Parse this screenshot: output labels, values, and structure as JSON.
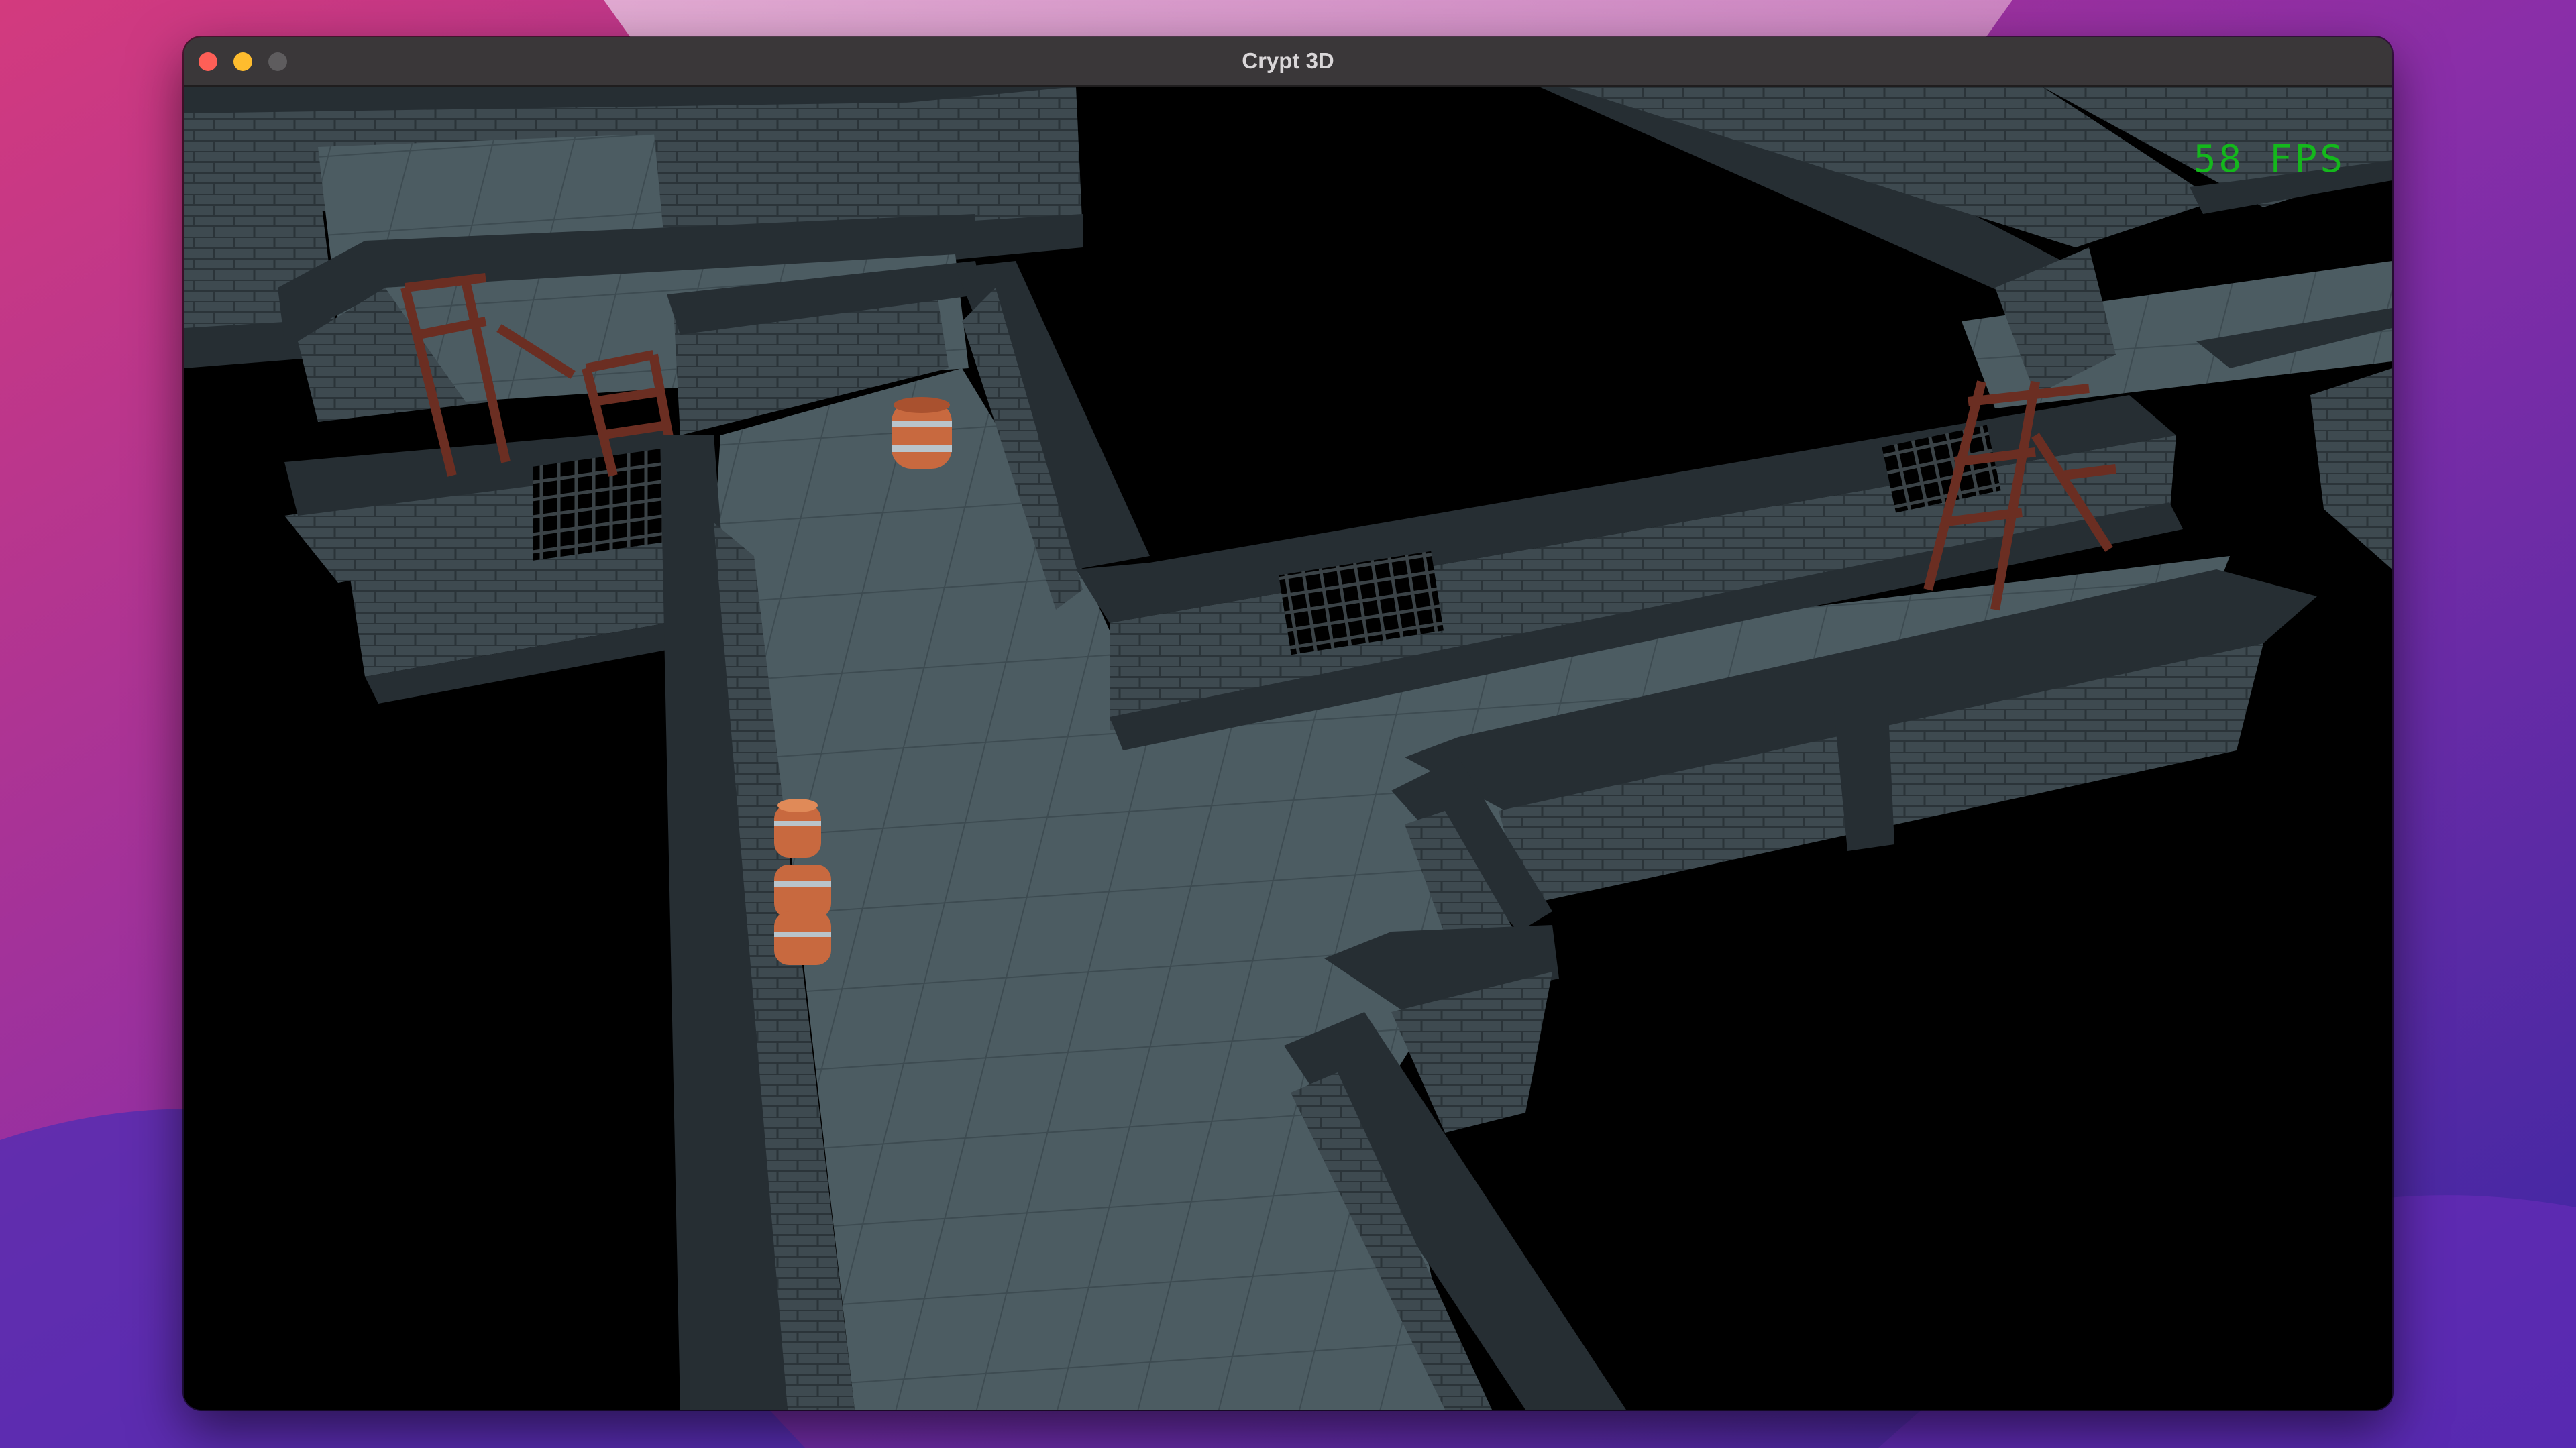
{
  "window": {
    "title": "Crypt 3D"
  },
  "hud": {
    "fps": "58 FPS"
  },
  "colors": {
    "floor": "#4c5c62",
    "wall_top": "#262e33",
    "brick": "#3e4a50",
    "barrel": "#c8693f",
    "fps_text": "#14b81c"
  }
}
